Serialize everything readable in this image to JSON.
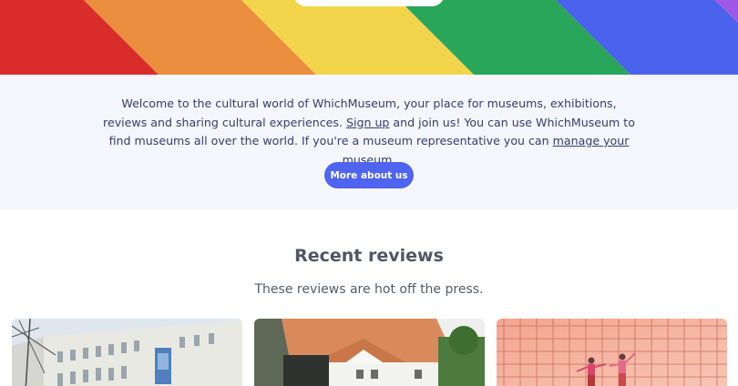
{
  "hero": {
    "stripe_colors": [
      "#db2c2c",
      "#eb8d3f",
      "#f3d54c",
      "#2aa65a",
      "#4b63ec",
      "#a157e6"
    ]
  },
  "intro": {
    "text_part1": "Welcome to the cultural world of WhichMuseum, your place for museums, exhibitions, reviews and sharing cultural experiences. ",
    "signup_link": "Sign up",
    "text_part2": " and join us! You can use WhichMuseum to find museums all over the world. If you're a museum representative you can ",
    "manage_link": "manage your museum",
    "text_part3": ".",
    "more_button": "More about us"
  },
  "reviews": {
    "title": "Recent reviews",
    "subtitle": "These reviews are hot off the press.",
    "cards": [
      {
        "image": "museum-building-photo"
      },
      {
        "image": "house-photo"
      },
      {
        "image": "exhibition-photo"
      }
    ]
  },
  "colors": {
    "accent": "#4f64f0",
    "intro_bg": "#f5f6fb",
    "text": "#34406b"
  }
}
